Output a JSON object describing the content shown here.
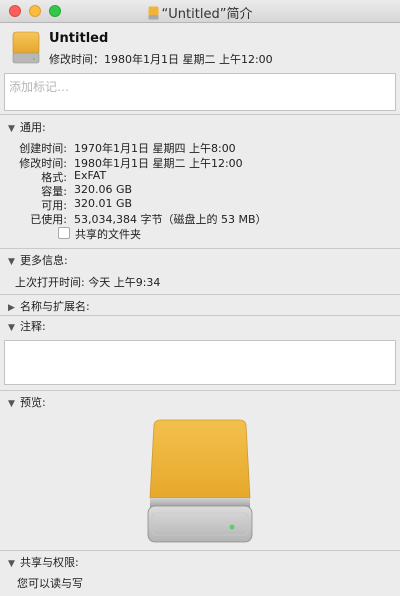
{
  "window": {
    "title": "“Untitled”简介",
    "close_icon": "close-icon",
    "minimize_icon": "minimize-icon",
    "zoom_icon": "zoom-icon"
  },
  "header": {
    "name": "Untitled",
    "modified": "修改时间：1980年1月1日 星期二 上午12:00",
    "icon": "external-drive-icon"
  },
  "tags": {
    "placeholder": "添加标记…"
  },
  "general": {
    "label": "通用:",
    "rows": [
      {
        "key": "创建时间:",
        "value": "1970年1月1日 星期四 上午8:00"
      },
      {
        "key": "修改时间:",
        "value": "1980年1月1日 星期二 上午12:00"
      },
      {
        "key": "格式:",
        "value": "ExFAT"
      },
      {
        "key": "容量:",
        "value": "320.06 GB"
      },
      {
        "key": "可用:",
        "value": "320.01 GB"
      },
      {
        "key": "已使用:",
        "value": "53,034,384 字节（磁盘上的 53 MB）"
      }
    ],
    "shared_folder_label": "共享的文件夹",
    "shared_folder_checked": false
  },
  "more_info": {
    "label": "更多信息:",
    "last_opened": "上次打开时间: 今天 上午9:34"
  },
  "name_ext": {
    "label": "名称与扩展名:"
  },
  "comments": {
    "label": "注释:",
    "value": ""
  },
  "preview": {
    "label": "预览:"
  },
  "sharing": {
    "label": "共享与权限:",
    "summary": "您可以读与写"
  },
  "colors": {
    "drive_orange": "#f0b43a",
    "window_bg": "#ececec",
    "close": "#fc605c",
    "minimize": "#fdbc40",
    "zoom": "#34c84a"
  }
}
